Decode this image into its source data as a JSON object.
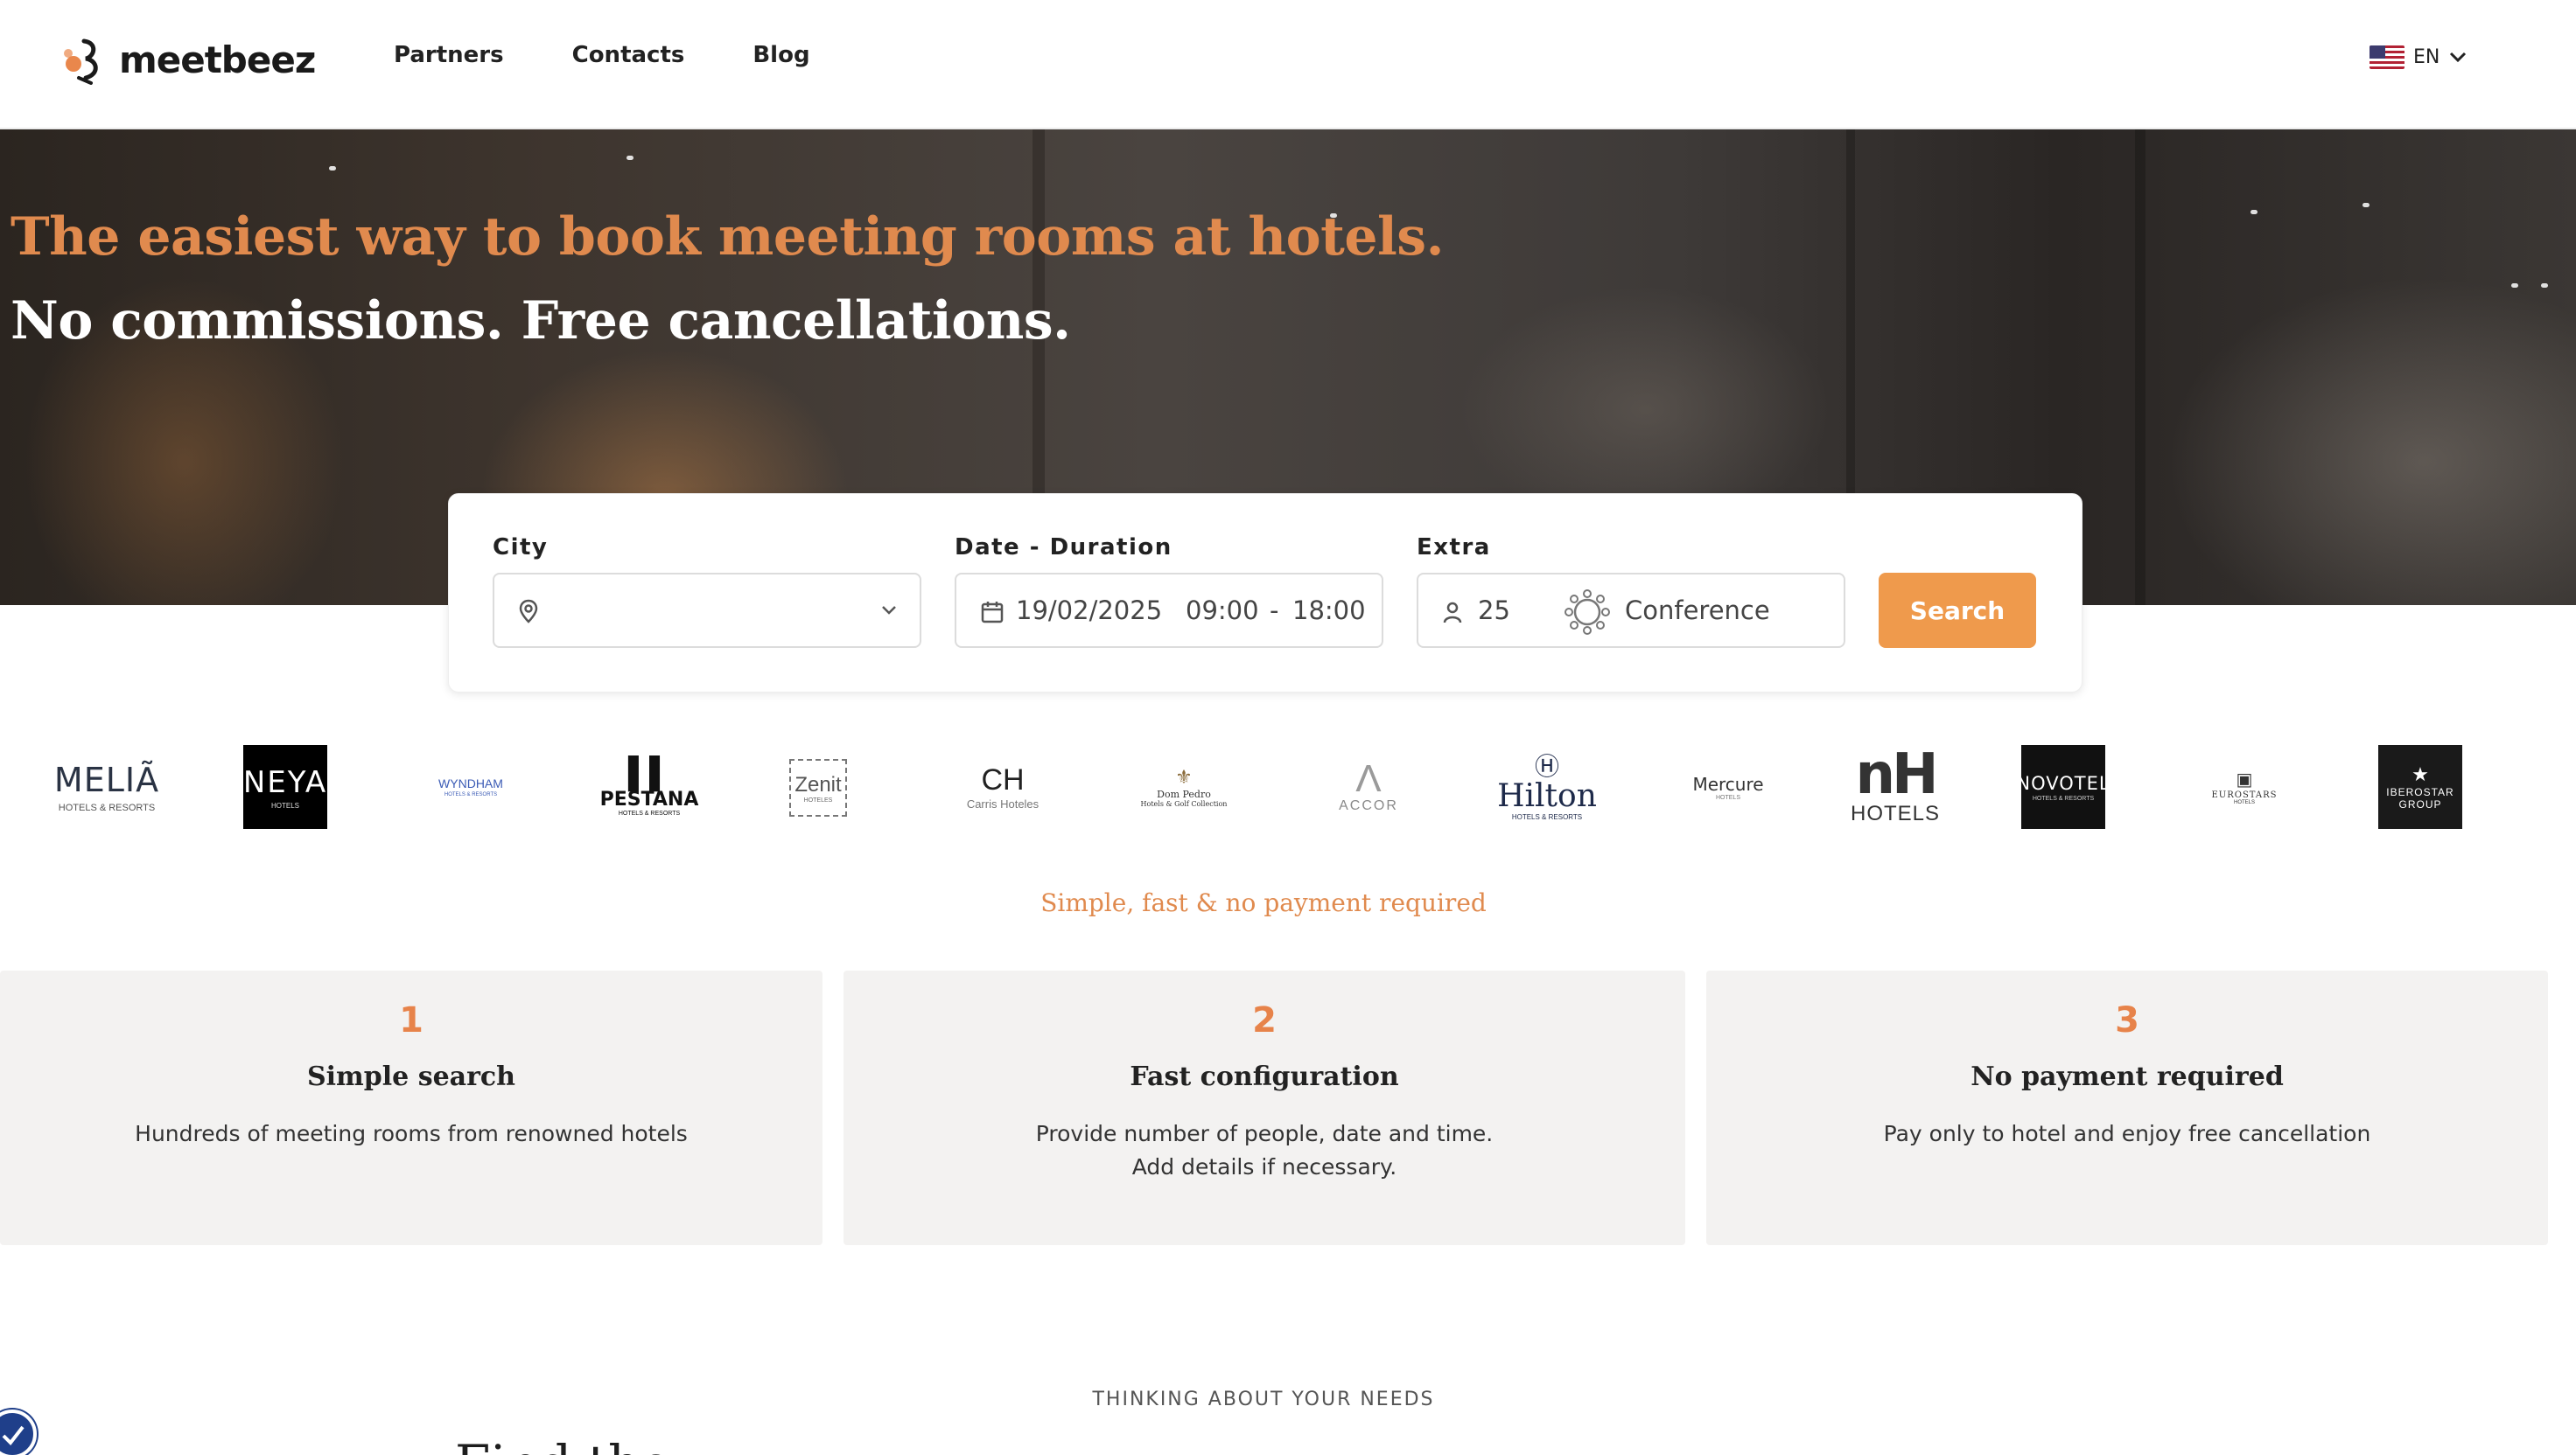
{
  "header": {
    "logo_text": "meetbeez",
    "nav": [
      {
        "label": "Partners"
      },
      {
        "label": "Contacts"
      },
      {
        "label": "Blog"
      }
    ],
    "language": {
      "code": "EN",
      "icon": "us-flag-icon"
    }
  },
  "hero": {
    "title": "The easiest way to book meeting rooms at hotels.",
    "subtitle": "No commissions. Free cancellations."
  },
  "search": {
    "city_label": "City",
    "city_value": "",
    "date_label": "Date - Duration",
    "date_value": "19/02/2025",
    "time_start": "09:00",
    "time_sep": "-",
    "time_end": "18:00",
    "extra_label": "Extra",
    "people": "25",
    "layout": "Conference",
    "button_label": "Search"
  },
  "brands": [
    {
      "name": "MELIÃ",
      "sub": "HOTELS & RESORTS"
    },
    {
      "name": "NEYA",
      "sub": "HOTELS"
    },
    {
      "name": "WYNDHAM",
      "sub": "HOTELS & RESORTS"
    },
    {
      "name": "PESTANA",
      "sub": "HOTELS & RESORTS"
    },
    {
      "name": "Zenit",
      "sub": "HOTELES"
    },
    {
      "name": "CH",
      "sub": "Carris Hoteles"
    },
    {
      "name": "Dom Pedro",
      "sub": "Hotels & Golf Collection"
    },
    {
      "name": "ACCOR",
      "sub": ""
    },
    {
      "name": "Hilton",
      "sub": "HOTELS & RESORTS"
    },
    {
      "name": "Mercure",
      "sub": "HOTELS"
    },
    {
      "name": "nH",
      "sub": "HOTELS"
    },
    {
      "name": "NOVOTEL",
      "sub": "HOTELS & RESORTS"
    },
    {
      "name": "EUROSTARS",
      "sub": "HOTELS"
    },
    {
      "name": "IBEROSTAR",
      "sub": "GROUP"
    }
  ],
  "tagline": "Simple, fast & no payment required",
  "steps": [
    {
      "number": "1",
      "title": "Simple search",
      "desc_line1": "Hundreds of meeting rooms from renowned hotels",
      "desc_line2": ""
    },
    {
      "number": "2",
      "title": "Fast configuration",
      "desc_line1": "Provide number of people, date and time.",
      "desc_line2": "Add details if necessary."
    },
    {
      "number": "3",
      "title": "No payment required",
      "desc_line1": "Pay only to hotel and enjoy free cancellation",
      "desc_line2": ""
    }
  ],
  "next_section": {
    "kicker": "THINKING ABOUT YOUR NEEDS",
    "heading_partial": "Find the ___ ___ ___ ___ ___"
  },
  "colors": {
    "accent": "#e08a4e",
    "button": "#ef9a4c",
    "step_bg": "#f3f2f1"
  }
}
